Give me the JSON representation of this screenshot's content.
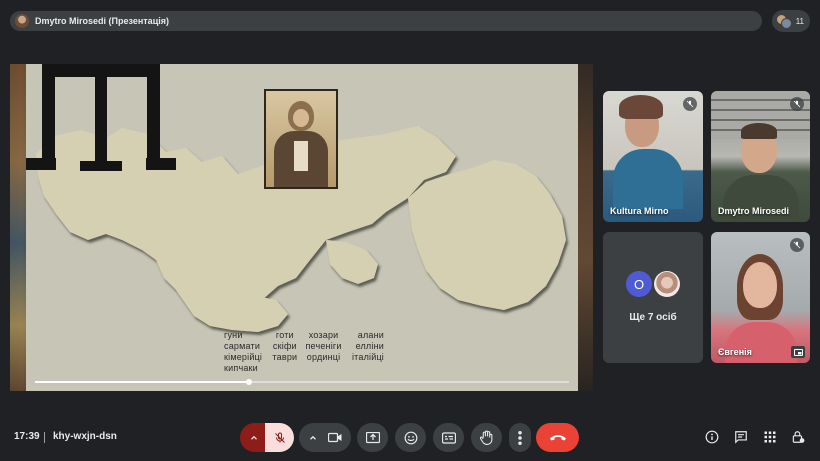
{
  "header": {
    "presenter_label": "Dmytro Mirosedi (Презентація)",
    "participant_count": "11"
  },
  "slide": {
    "tribes": [
      "гуни",
      "готи",
      "хозари",
      "алани",
      "сармати",
      "скіфи",
      "печеніги",
      "елліни",
      "кімерійці",
      "таври",
      "ординці",
      "італійці",
      "кипчаки"
    ],
    "video_progress": 0.4
  },
  "participants": [
    {
      "name": "Kultura Mirno",
      "muted": true
    },
    {
      "name": "Dmytro Mirosedi",
      "muted": true
    },
    {
      "others_initial": "O",
      "others_label": "Ще 7 осіб"
    },
    {
      "name": "Євгенія",
      "muted": true
    }
  ],
  "bottom": {
    "time": "17:39",
    "meeting_code": "khy-wxjn-dsn"
  },
  "colors": {
    "hangup": "#ea4335",
    "mic_off_bg": "#f9dedc",
    "mic_group_bg": "#8c1d18",
    "avatar_o": "#4f5bd5"
  },
  "icons": [
    "chevron-up-icon",
    "mic-off-icon",
    "camera-icon",
    "present-icon",
    "emoji-icon",
    "captions-icon",
    "raise-hand-icon",
    "more-icon",
    "hangup-icon",
    "info-icon",
    "chat-icon",
    "activities-icon",
    "host-controls-icon"
  ]
}
